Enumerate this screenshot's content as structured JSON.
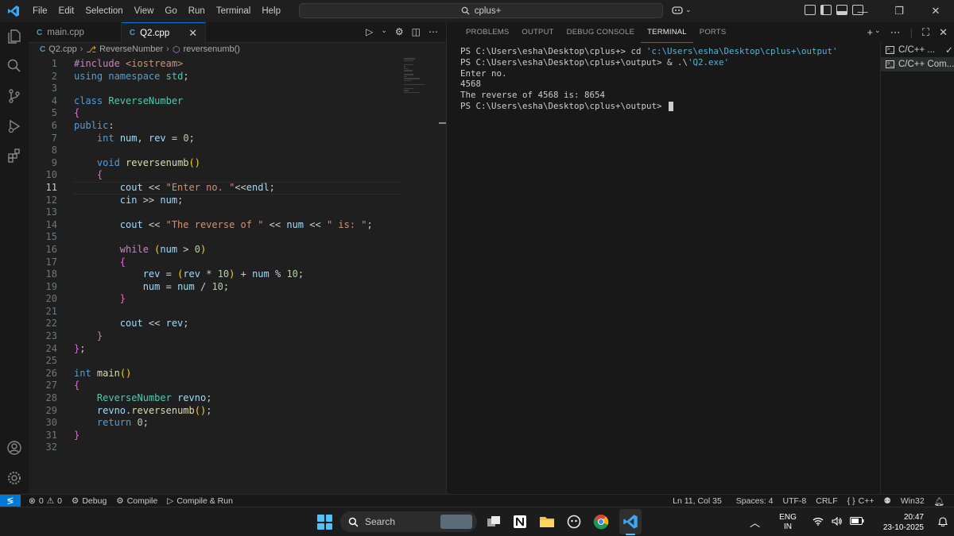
{
  "menu": [
    "File",
    "Edit",
    "Selection",
    "View",
    "Go",
    "Run",
    "Terminal",
    "Help"
  ],
  "search_text": "cplus+",
  "editor": {
    "tabs": [
      {
        "label": "main.cpp",
        "active": false
      },
      {
        "label": "Q2.cpp",
        "active": true
      }
    ],
    "breadcrumb": [
      "Q2.cpp",
      "ReverseNumber",
      "reversenumb()"
    ],
    "current_line": 11,
    "line_numbers": [
      "1",
      "2",
      "3",
      "4",
      "5",
      "6",
      "7",
      "8",
      "9",
      "10",
      "11",
      "12",
      "13",
      "14",
      "15",
      "16",
      "17",
      "18",
      "19",
      "20",
      "21",
      "22",
      "23",
      "24",
      "25",
      "26",
      "27",
      "28",
      "29",
      "30",
      "31",
      "32"
    ],
    "code": [
      "#include <iostream>",
      "using namespace std;",
      "",
      "class ReverseNumber",
      "{",
      "public:",
      "    int num, rev = 0;",
      "",
      "    void reversenumb()",
      "    {",
      "        cout << \"Enter no. \"<<endl;",
      "        cin >> num;",
      "",
      "        cout << \"The reverse of \" << num << \" is: \";",
      "",
      "        while (num > 0)",
      "        {",
      "            rev = (rev * 10) + num % 10;",
      "            num = num / 10;",
      "        }",
      "",
      "        cout << rev;",
      "    }",
      "};",
      "",
      "int main()",
      "{",
      "    ReverseNumber revno;",
      "    revno.reversenumb();",
      "    return 0;",
      "}",
      ""
    ]
  },
  "panel": {
    "tabs": [
      "PROBLEMS",
      "OUTPUT",
      "DEBUG CONSOLE",
      "TERMINAL",
      "PORTS"
    ],
    "active_tab": "TERMINAL",
    "terminal_lines": [
      "PS C:\\Users\\esha\\Desktop\\cplus+> cd 'c:\\Users\\esha\\Desktop\\cplus+\\output'",
      "PS C:\\Users\\esha\\Desktop\\cplus+\\output> & .\\'Q2.exe'",
      "Enter no.",
      "4568",
      "The reverse of 4568 is: 8654",
      "PS C:\\Users\\esha\\Desktop\\cplus+\\output> "
    ],
    "terminal_list": [
      "C/C++ ...",
      "C/C++ Com..."
    ]
  },
  "statusbar": {
    "errors": "0",
    "warnings": "0",
    "debug": "Debug",
    "compile": "Compile",
    "compile_run": "Compile & Run",
    "position": "Ln 11, Col 35",
    "spaces": "Spaces: 4",
    "encoding": "UTF-8",
    "eol": "CRLF",
    "language": "C++",
    "language_prefix": "{ }",
    "platform": "Win32"
  },
  "taskbar": {
    "search": "Search",
    "lang_top": "ENG",
    "lang_bottom": "IN",
    "time": "20:47",
    "date": "23-10-2025"
  },
  "colors": {
    "accent": "#0078d4",
    "keyword": "#569cd6",
    "control": "#c586c0",
    "type": "#4ec9b0",
    "function": "#dcdcaa",
    "variable": "#9cdcfe",
    "string": "#ce9178",
    "number": "#b5cea8"
  }
}
